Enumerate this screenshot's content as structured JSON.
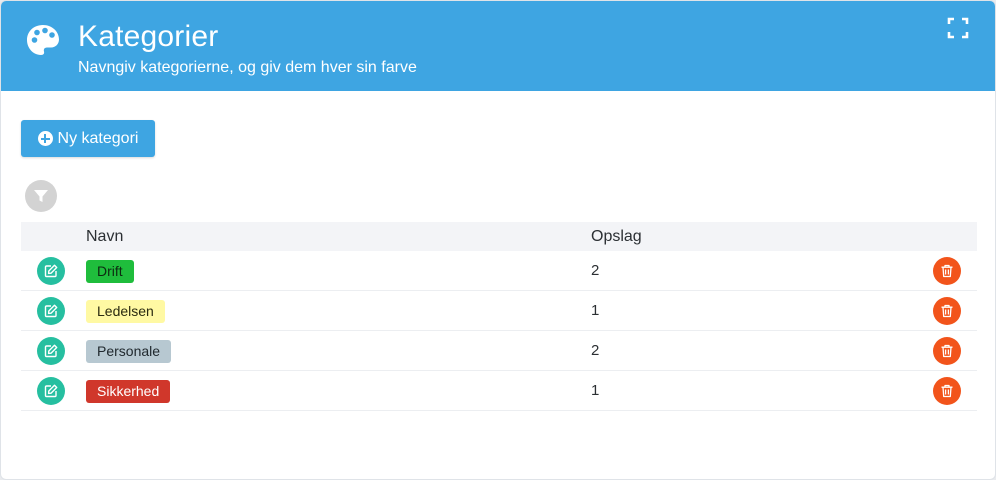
{
  "header": {
    "title": "Kategorier",
    "subtitle": "Navngiv kategorierne, og giv dem hver sin farve",
    "icon": "palette-icon",
    "fullscreen_icon": "fullscreen-icon",
    "color": "#3ea5e2"
  },
  "toolbar": {
    "new_label": "Ny kategori",
    "new_icon": "plus-circle-icon",
    "filter_icon": "filter-icon"
  },
  "table": {
    "columns": {
      "name": "Navn",
      "posts": "Opslag"
    },
    "rows": [
      {
        "name": "Drift",
        "count": "2",
        "tag_color": "#1fbd3c",
        "text_color": "#0d2a10"
      },
      {
        "name": "Ledelsen",
        "count": "1",
        "tag_color": "#fff9a3",
        "text_color": "#2b2b10"
      },
      {
        "name": "Personale",
        "count": "2",
        "tag_color": "#b7c8d1",
        "text_color": "#20292e"
      },
      {
        "name": "Sikkerhed",
        "count": "1",
        "tag_color": "#d0372b",
        "text_color": "#ffffff"
      }
    ],
    "edit_icon": "edit-icon",
    "delete_icon": "trash-icon",
    "edit_color": "#26bfa0",
    "delete_color": "#f2541b"
  }
}
